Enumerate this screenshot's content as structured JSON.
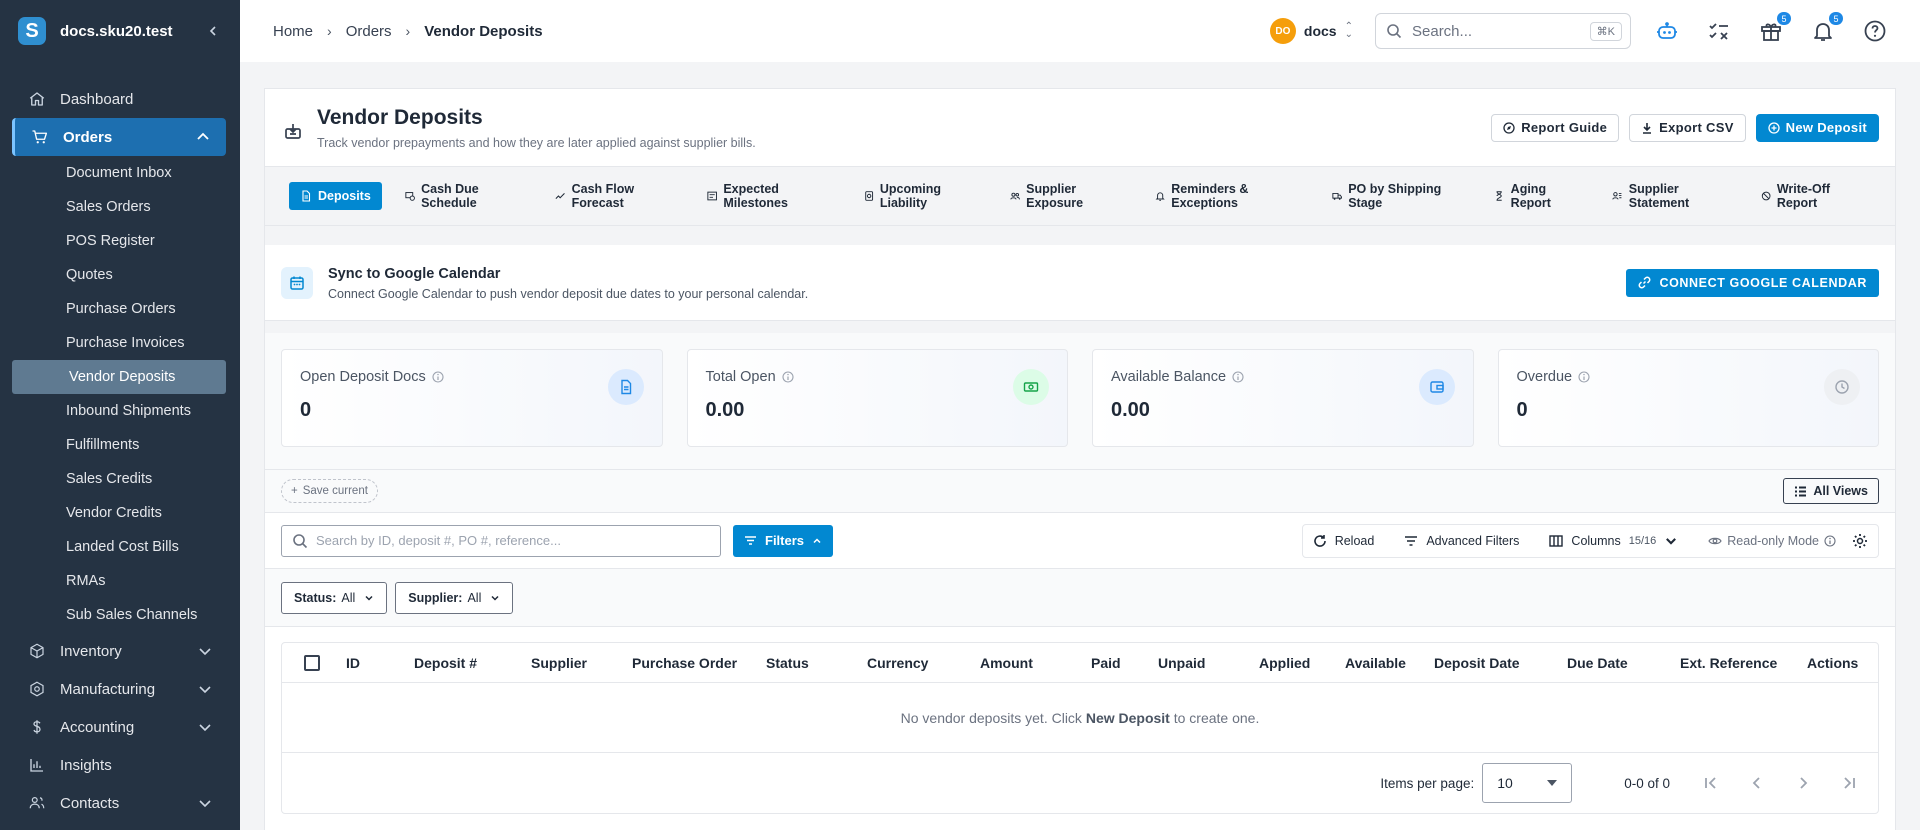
{
  "app": {
    "title": "docs.sku20.test"
  },
  "sidebar": {
    "items": [
      {
        "label": "Dashboard"
      },
      {
        "label": "Orders"
      },
      {
        "label": "Inventory"
      },
      {
        "label": "Manufacturing"
      },
      {
        "label": "Accounting"
      },
      {
        "label": "Insights"
      },
      {
        "label": "Contacts"
      }
    ],
    "orders_sub": [
      {
        "label": "Document Inbox"
      },
      {
        "label": "Sales Orders"
      },
      {
        "label": "POS Register"
      },
      {
        "label": "Quotes"
      },
      {
        "label": "Purchase Orders"
      },
      {
        "label": "Purchase Invoices"
      },
      {
        "label": "Vendor Deposits"
      },
      {
        "label": "Inbound Shipments"
      },
      {
        "label": "Fulfillments"
      },
      {
        "label": "Sales Credits"
      },
      {
        "label": "Vendor Credits"
      },
      {
        "label": "Landed Cost Bills"
      },
      {
        "label": "RMAs"
      },
      {
        "label": "Sub Sales Channels"
      }
    ]
  },
  "topbar": {
    "breadcrumbs": [
      "Home",
      "Orders",
      "Vendor Deposits"
    ],
    "org_initials": "DO",
    "org_name": "docs",
    "search_placeholder": "Search...",
    "search_shortcut": "⌘K",
    "gift_badge": "5",
    "bell_badge": "5"
  },
  "page": {
    "title": "Vendor Deposits",
    "subtitle": "Track vendor prepayments and how they are later applied against supplier bills.",
    "actions": {
      "guide": "Report Guide",
      "export": "Export CSV",
      "new": "New Deposit"
    },
    "tabs": [
      {
        "label": "Deposits"
      },
      {
        "label": "Cash Due Schedule"
      },
      {
        "label": "Cash Flow Forecast"
      },
      {
        "label": "Expected Milestones"
      },
      {
        "label": "Upcoming Liability"
      },
      {
        "label": "Supplier Exposure"
      },
      {
        "label": "Reminders & Exceptions"
      },
      {
        "label": "PO by Shipping Stage"
      },
      {
        "label": "Aging Report"
      },
      {
        "label": "Supplier Statement"
      },
      {
        "label": "Write-Off Report"
      }
    ]
  },
  "gcal": {
    "title": "Sync to Google Calendar",
    "desc": "Connect Google Calendar to push vendor deposit due dates to your personal calendar.",
    "button": "CONNECT GOOGLE CALENDAR"
  },
  "kpis": [
    {
      "label": "Open Deposit Docs",
      "value": "0",
      "icon": "document-icon",
      "color": "#1e88e5",
      "bg": "#dbeafe"
    },
    {
      "label": "Total Open",
      "value": "0.00",
      "icon": "cash-icon",
      "color": "#16a34a",
      "bg": "#dcfce7"
    },
    {
      "label": "Available Balance",
      "value": "0.00",
      "icon": "wallet-icon",
      "color": "#1e88e5",
      "bg": "#dbeafe"
    },
    {
      "label": "Overdue",
      "value": "0",
      "icon": "clock-icon",
      "color": "#9ca3af",
      "bg": "#eef0f3"
    }
  ],
  "views": {
    "save": "Save current",
    "all": "All Views"
  },
  "toolbar": {
    "search_placeholder": "Search by ID, deposit #, PO #, reference...",
    "filters": "Filters",
    "reload": "Reload",
    "advanced": "Advanced Filters",
    "columns": "Columns",
    "columns_count": "15/16",
    "readonly": "Read-only Mode"
  },
  "chips": [
    {
      "label": "Status:",
      "value": "All"
    },
    {
      "label": "Supplier:",
      "value": "All"
    }
  ],
  "table": {
    "columns": [
      "ID",
      "Deposit #",
      "Supplier",
      "Purchase Order",
      "Status",
      "Currency",
      "Amount",
      "Paid",
      "Unpaid",
      "Applied",
      "Available",
      "Deposit Date",
      "Due Date",
      "Ext. Reference",
      "Actions"
    ],
    "empty_pre": "No vendor deposits yet. Click",
    "empty_bold": "New Deposit",
    "empty_post": "to create one."
  },
  "pager": {
    "label": "Items per page:",
    "value": "10",
    "range": "0-0 of 0"
  }
}
